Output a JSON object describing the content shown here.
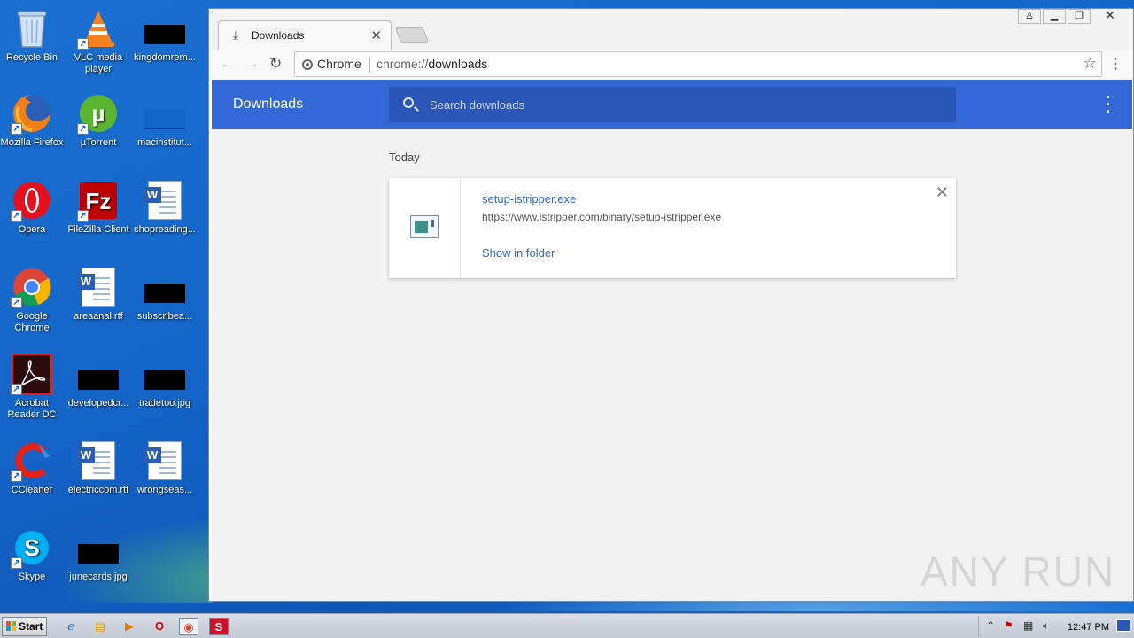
{
  "desktop": {
    "icons": [
      {
        "label": "Recycle Bin"
      },
      {
        "label": "VLC media player"
      },
      {
        "label": "kingdomrem..."
      },
      {
        "label": "Mozilla Firefox"
      },
      {
        "label": "µTorrent"
      },
      {
        "label": "macinstitut..."
      },
      {
        "label": "Opera"
      },
      {
        "label": "FileZilla Client"
      },
      {
        "label": "shopreading..."
      },
      {
        "label": "Google Chrome"
      },
      {
        "label": "areaanal.rtf"
      },
      {
        "label": "subscribea..."
      },
      {
        "label": "Acrobat Reader DC"
      },
      {
        "label": "developedcr..."
      },
      {
        "label": "tradetoo.jpg"
      },
      {
        "label": "CCleaner"
      },
      {
        "label": "electriccom.rtf"
      },
      {
        "label": "wrongseas..."
      },
      {
        "label": "Skype"
      },
      {
        "label": "junecards.jpg"
      }
    ]
  },
  "browser": {
    "tab_title": "Downloads",
    "site_name": "Chrome",
    "url_scheme": "chrome://",
    "url_path": "downloads",
    "page": {
      "header_title": "Downloads",
      "search_placeholder": "Search downloads",
      "section_label": "Today",
      "download": {
        "file_name": "setup-istripper.exe",
        "file_url": "https://www.istripper.com/binary/setup-istripper.exe",
        "action": "Show in folder"
      }
    }
  },
  "watermark": "ANY RUN",
  "taskbar": {
    "start_label": "Start",
    "clock": "12:47 PM"
  }
}
